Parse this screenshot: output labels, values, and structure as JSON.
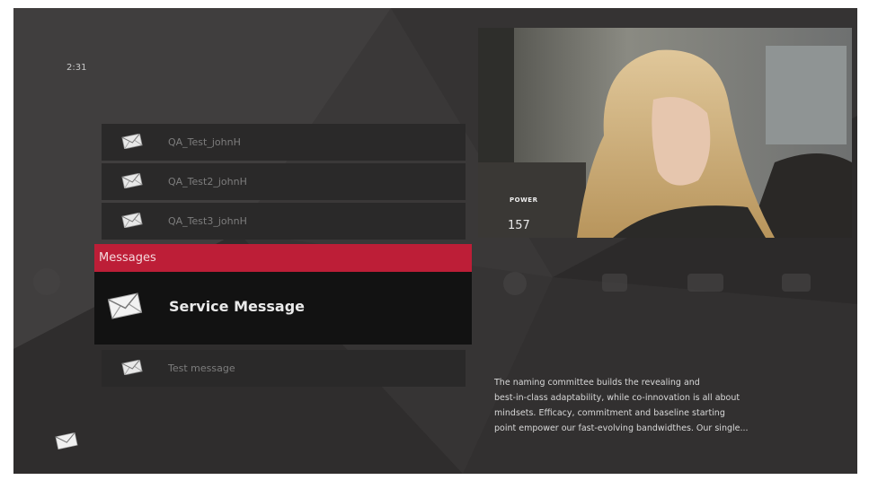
{
  "clock": "2:31",
  "messages_list": {
    "items_above": [
      {
        "label": "QA_Test_johnH"
      },
      {
        "label": "QA_Test2_johnH"
      },
      {
        "label": "QA_Test3_johnH"
      }
    ],
    "header": "Messages",
    "selected": {
      "label": "Service Message"
    },
    "items_below": [
      {
        "label": "Test message"
      }
    ]
  },
  "video_preview": {
    "channel_name": "POWER",
    "channel_number": "157"
  },
  "description": {
    "lines": [
      "The naming committee builds the revealing and",
      "best-in-class adaptability, while co-innovation is all about",
      "mindsets. Efficacy, commitment and baseline starting",
      "point empower our fast-evolving bandwidthes. Our single..."
    ]
  },
  "colors": {
    "accent": "#bd1e37",
    "background": "#3a3838",
    "list_item": "#2a2929",
    "selected": "#121212"
  },
  "icons": {
    "message": "envelope-icon"
  }
}
